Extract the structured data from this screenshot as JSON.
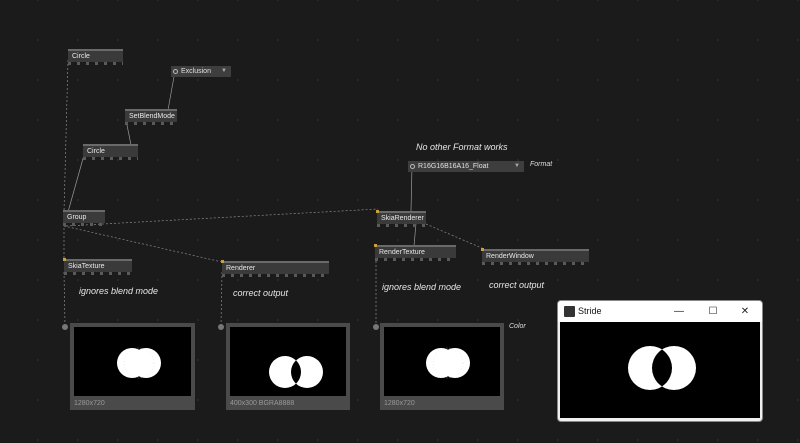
{
  "nodes": {
    "circle1": "Circle",
    "circle2": "Circle",
    "set_blend_mode": "SetBlendMode",
    "group": "Group",
    "skia_texture": "SkiaTexture",
    "renderer": "Renderer",
    "skia_renderer": "SkiaRenderer",
    "render_texture": "RenderTexture",
    "render_window": "RenderWindow"
  },
  "enums": {
    "blend_mode": "Exclusion",
    "format": "R16G16B16A16_Float"
  },
  "labels": {
    "format": "Format",
    "color": "Color"
  },
  "comments": {
    "no_other_format": "No other Format works",
    "ignores1": "ignores blend mode",
    "correct1": "correct output",
    "ignores2": "ignores blend mode",
    "correct2": "correct output"
  },
  "previews": {
    "p1": "1280x720",
    "p2": "400x300 BGRA8888",
    "p3": "1280x720"
  },
  "window": {
    "title": "Stride",
    "minimize": "—",
    "maximize": "☐",
    "close": "✕"
  },
  "colors": {
    "background": "#1b1b1b",
    "node": "#3a3a3a",
    "window_client": "#000000"
  }
}
